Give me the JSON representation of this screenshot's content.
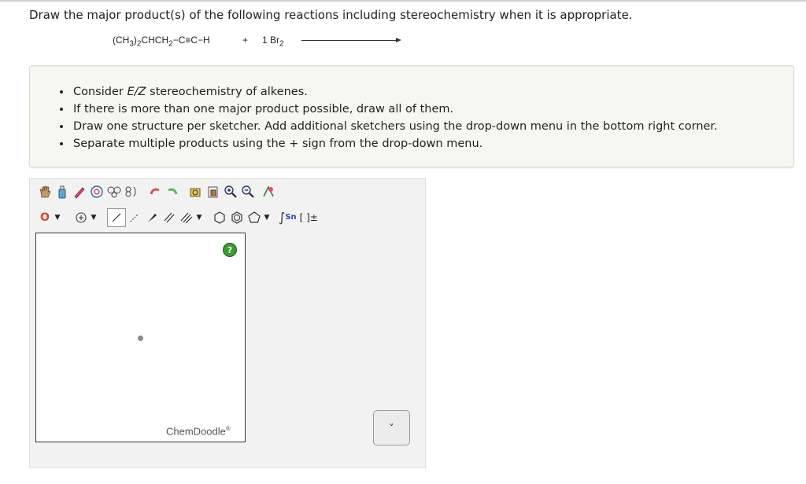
{
  "question": "Draw the major product(s) of the following reactions including stereochemistry when it is appropriate.",
  "reaction": {
    "reactant_prefix": "(CH",
    "reactant_sub1": "3",
    "reactant_mid": ")",
    "reactant_sub2": "2",
    "reactant_suffix": "CHCH",
    "reactant_sub3": "2",
    "reactant_tail": "−C≡C−H",
    "plus": "+",
    "reagent_prefix": "1 Br",
    "reagent_sub": "2"
  },
  "instructions": [
    {
      "pre": "Consider ",
      "em": "E/Z",
      "post": " stereochemistry of alkenes."
    },
    {
      "pre": "If there is more than one major product possible, draw all of them.",
      "em": "",
      "post": ""
    },
    {
      "pre": "Draw one structure per sketcher. Add additional sketchers using the drop-down menu in the bottom right corner.",
      "em": "",
      "post": ""
    },
    {
      "pre": "Separate multiple products using the + sign from the drop-down menu.",
      "em": "",
      "post": ""
    }
  ],
  "toolbar": {
    "row1": [
      "hand-icon",
      "eraser-bottle-icon",
      "eraser-pencil-icon",
      "ring-template-icon",
      "chain-template-icon",
      "bracket-template-icon",
      "undo-icon",
      "redo-icon",
      "copy-icon",
      "paste-icon",
      "zoom-in-icon",
      "zoom-out-icon",
      "clean-icon"
    ],
    "element_label": "O",
    "sgroup_label": "Sn",
    "bracket_label": "[ ]±"
  },
  "canvas": {
    "help_label": "?",
    "brand": "ChemDoodle",
    "brand_mark": "®"
  },
  "add_sketcher": {
    "chevron": "˅"
  }
}
